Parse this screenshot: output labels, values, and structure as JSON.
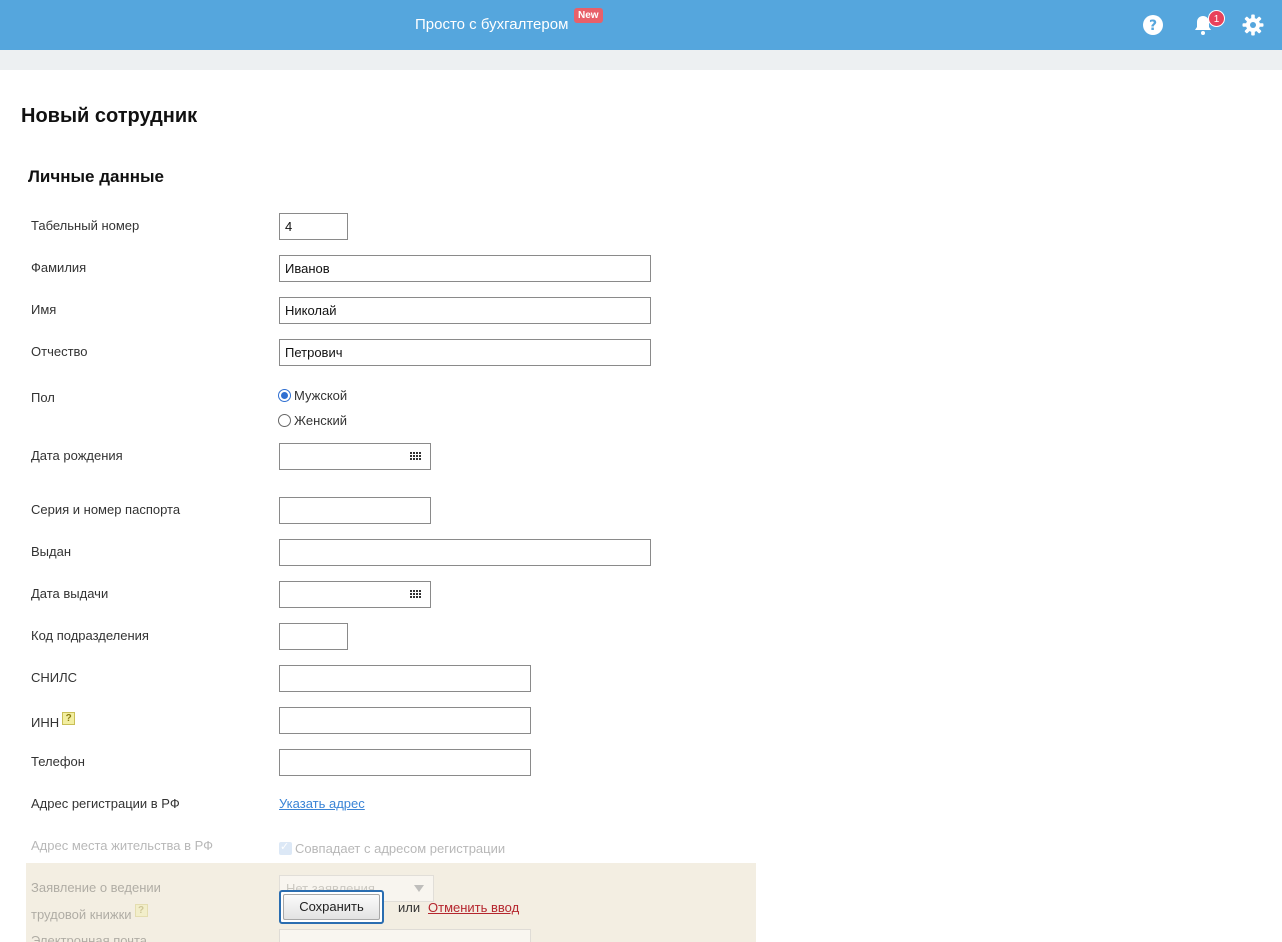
{
  "header": {
    "brand": "Просто с бухгалтером",
    "badge": "New",
    "notifications_count": "1",
    "colors": {
      "bar": "#55a6dd",
      "badge": "#e8606a",
      "notif": "#e8425a"
    },
    "icons": [
      "help-icon",
      "bell-icon",
      "gear-icon"
    ]
  },
  "page": {
    "title": "Новый сотрудник",
    "section": "Личные данные"
  },
  "form": {
    "tab_number": {
      "label": "Табельный номер",
      "value": "4"
    },
    "last_name": {
      "label": "Фамилия",
      "value": "Иванов"
    },
    "first_name": {
      "label": "Имя",
      "value": "Николай"
    },
    "middle_name": {
      "label": "Отчество",
      "value": "Петрович"
    },
    "gender": {
      "label": "Пол",
      "options": [
        "Мужской",
        "Женский"
      ],
      "selected": "Мужской"
    },
    "birth_date": {
      "label": "Дата рождения",
      "value": ""
    },
    "passport": {
      "label": "Серия и номер паспорта",
      "value": ""
    },
    "issued_by": {
      "label": "Выдан",
      "value": ""
    },
    "issue_date": {
      "label": "Дата выдачи",
      "value": ""
    },
    "division_code": {
      "label": "Код подразделения",
      "value": ""
    },
    "snils": {
      "label": "СНИЛС",
      "value": ""
    },
    "inn": {
      "label": "ИНН",
      "help": "?",
      "value": ""
    },
    "phone": {
      "label": "Телефон",
      "value": ""
    },
    "reg_address": {
      "label": "Адрес регистрации в РФ",
      "link": "Указать адрес"
    },
    "live_address": {
      "label": "Адрес места жительства в РФ",
      "checkbox": "Совпадает с адресом регистрации",
      "checked": true
    },
    "work_book": {
      "label_line1": "Заявление о ведении",
      "label_line2": "трудовой книжки",
      "help": "?",
      "select_value": "Нет заявления"
    },
    "email": {
      "label": "Электронная почта"
    }
  },
  "actions": {
    "save": "Сохранить",
    "or": "или",
    "cancel": "Отменить ввод"
  }
}
